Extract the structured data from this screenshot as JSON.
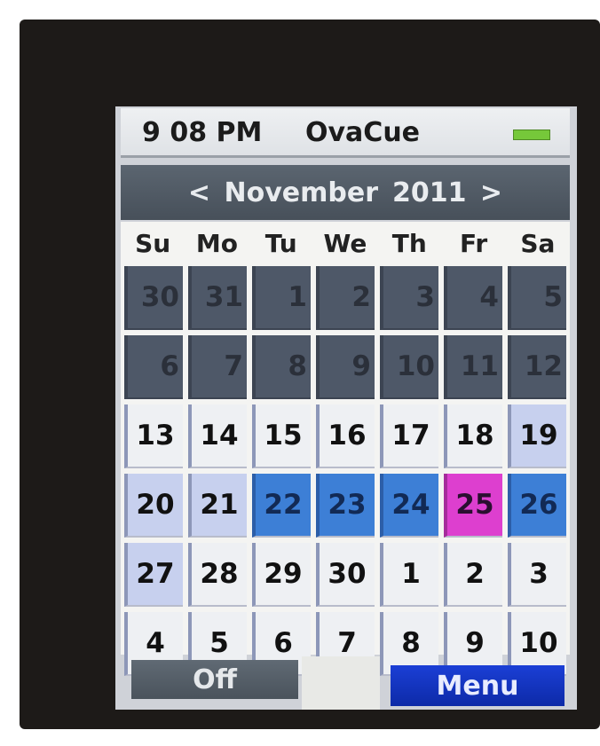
{
  "status_bar": {
    "time": "9 08 PM",
    "app_name": "OvaCue",
    "battery_color": "#76c83a"
  },
  "calendar_header": {
    "prev_label": "<",
    "month": "November",
    "year": "2011",
    "next_label": ">"
  },
  "weekdays": [
    "Su",
    "Mo",
    "Tu",
    "We",
    "Th",
    "Fr",
    "Sa"
  ],
  "days": [
    {
      "label": "30",
      "style": "past"
    },
    {
      "label": "31",
      "style": "past"
    },
    {
      "label": "1",
      "style": "past"
    },
    {
      "label": "2",
      "style": "past"
    },
    {
      "label": "3",
      "style": "past"
    },
    {
      "label": "4",
      "style": "past"
    },
    {
      "label": "5",
      "style": "past"
    },
    {
      "label": "6",
      "style": "past"
    },
    {
      "label": "7",
      "style": "past"
    },
    {
      "label": "8",
      "style": "past"
    },
    {
      "label": "9",
      "style": "past"
    },
    {
      "label": "10",
      "style": "past"
    },
    {
      "label": "11",
      "style": "past"
    },
    {
      "label": "12",
      "style": "past"
    },
    {
      "label": "13",
      "style": "normal"
    },
    {
      "label": "14",
      "style": "normal"
    },
    {
      "label": "15",
      "style": "normal"
    },
    {
      "label": "16",
      "style": "normal"
    },
    {
      "label": "17",
      "style": "normal"
    },
    {
      "label": "18",
      "style": "normal"
    },
    {
      "label": "19",
      "style": "light"
    },
    {
      "label": "20",
      "style": "light"
    },
    {
      "label": "21",
      "style": "light"
    },
    {
      "label": "22",
      "style": "blue"
    },
    {
      "label": "23",
      "style": "blue"
    },
    {
      "label": "24",
      "style": "blue"
    },
    {
      "label": "25",
      "style": "magenta"
    },
    {
      "label": "26",
      "style": "blue"
    },
    {
      "label": "27",
      "style": "light"
    },
    {
      "label": "28",
      "style": "normal"
    },
    {
      "label": "29",
      "style": "normal"
    },
    {
      "label": "30",
      "style": "normal"
    },
    {
      "label": "1",
      "style": "normal"
    },
    {
      "label": "2",
      "style": "normal"
    },
    {
      "label": "3",
      "style": "normal"
    },
    {
      "label": "4",
      "style": "normal"
    },
    {
      "label": "5",
      "style": "normal"
    },
    {
      "label": "6",
      "style": "normal"
    },
    {
      "label": "7",
      "style": "normal"
    },
    {
      "label": "8",
      "style": "normal"
    },
    {
      "label": "9",
      "style": "normal"
    },
    {
      "label": "10",
      "style": "normal"
    }
  ],
  "buttons": {
    "off_label": "Off",
    "menu_label": "Menu"
  },
  "colors": {
    "past": "#4e5868",
    "normal": "#eef0f3",
    "light": "#c7d0ee",
    "blue": "#3d7fd6",
    "magenta": "#dd3fcf",
    "menu": "#1b3fd6"
  }
}
